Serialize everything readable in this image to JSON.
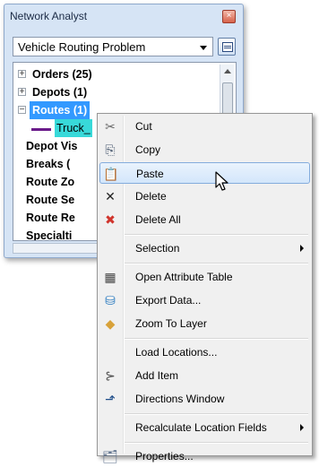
{
  "window": {
    "title": "Network Analyst",
    "close_glyph": "×",
    "layer_dropdown": {
      "selected": "Vehicle Routing Problem"
    },
    "tree": [
      {
        "label": "Orders (25)",
        "expander": "+",
        "selected": false
      },
      {
        "label": "Depots (1)",
        "expander": "+",
        "selected": false
      },
      {
        "label": "Routes (1)",
        "expander": "−",
        "selected": true
      },
      {
        "label": "Truck_",
        "type": "route-feature"
      },
      {
        "label": "Depot Vis"
      },
      {
        "label": "Breaks ("
      },
      {
        "label": "Route Zo"
      },
      {
        "label": "Route Se"
      },
      {
        "label": "Route Re"
      },
      {
        "label": "Specialti"
      }
    ]
  },
  "context_menu": {
    "items": [
      {
        "label": "Cut",
        "icon": "scissors-icon",
        "glyph": "✂",
        "color": "#6a6a6a"
      },
      {
        "label": "Copy",
        "icon": "copy-icon",
        "glyph": "⎘",
        "color": "#44556b"
      },
      {
        "label": "Paste",
        "icon": "paste-icon",
        "glyph": "📋",
        "color": "#8a6a2a",
        "highlighted": true
      },
      {
        "label": "Delete",
        "icon": "delete-icon",
        "glyph": "✕",
        "color": "#222222"
      },
      {
        "label": "Delete All",
        "icon": "delete-all-icon",
        "glyph": "✖",
        "color": "#d0342c"
      },
      {
        "separator": true
      },
      {
        "label": "Selection",
        "submenu": true
      },
      {
        "separator": true
      },
      {
        "label": "Open Attribute Table",
        "icon": "table-icon",
        "glyph": "▦",
        "color": "#444444"
      },
      {
        "label": "Export Data...",
        "icon": "export-data-icon",
        "glyph": "⛁",
        "color": "#2a7bc0"
      },
      {
        "label": "Zoom To Layer",
        "icon": "zoom-to-layer-icon",
        "glyph": "◆",
        "color": "#d8a23a"
      },
      {
        "separator": true
      },
      {
        "label": "Load Locations..."
      },
      {
        "label": "Add Item",
        "icon": "add-item-icon",
        "glyph": "⊱",
        "color": "#555555"
      },
      {
        "label": "Directions Window",
        "icon": "directions-icon",
        "glyph": "⬏",
        "color": "#1f4e8a"
      },
      {
        "separator": true
      },
      {
        "label": "Recalculate Location Fields",
        "submenu": true
      },
      {
        "separator": true
      },
      {
        "label": "Properties...",
        "icon": "properties-icon",
        "glyph": "🗂",
        "color": "#5a6e8a"
      }
    ]
  }
}
